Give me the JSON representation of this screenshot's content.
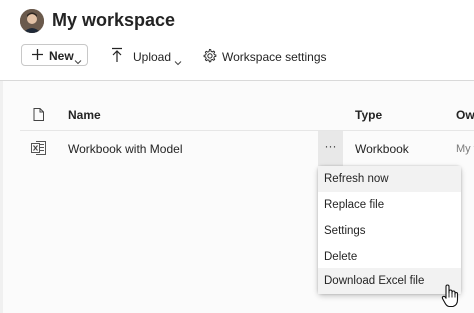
{
  "workspace": {
    "title": "My workspace"
  },
  "toolbar": {
    "new_label": "New",
    "upload_label": "Upload",
    "settings_label": "Workspace settings"
  },
  "table": {
    "headers": {
      "name": "Name",
      "type": "Type",
      "owner": "Own"
    },
    "rows": [
      {
        "name": "Workbook with Model",
        "more": "···",
        "type": "Workbook",
        "owner": "My w"
      }
    ]
  },
  "context_menu": {
    "items": [
      {
        "label": "Refresh now"
      },
      {
        "label": "Replace file"
      },
      {
        "label": "Settings"
      },
      {
        "label": "Delete"
      },
      {
        "label": "Download Excel file"
      }
    ]
  },
  "icons": {
    "avatar": "user-avatar",
    "new": "plus-icon",
    "upload": "upload-arrow-icon",
    "settings": "gear-icon",
    "file": "file-icon",
    "excel": "excel-file-icon",
    "cursor": "hand-pointer-icon"
  }
}
